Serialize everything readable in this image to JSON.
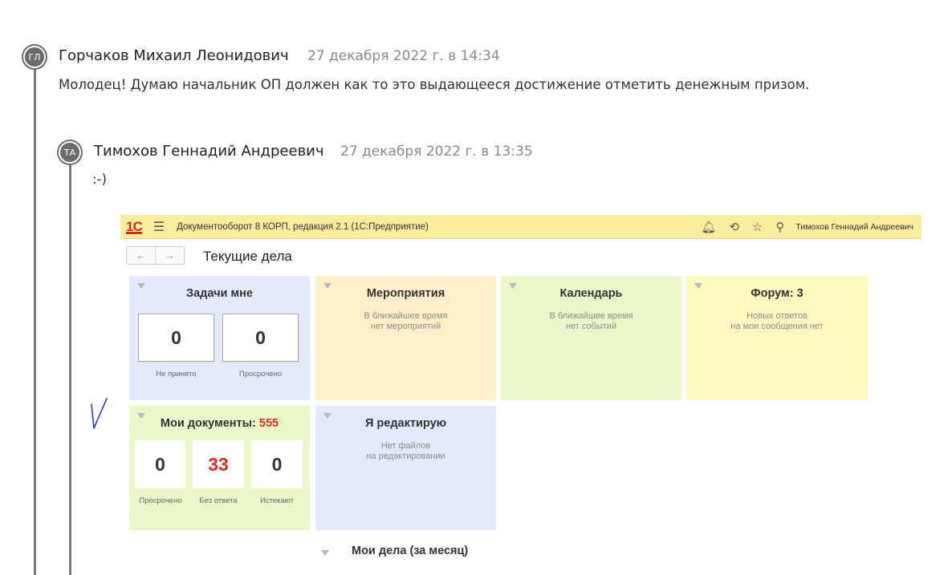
{
  "comments": [
    {
      "avatar_initials": "ГЛ",
      "author": "Горчаков Михаил Леонидович",
      "date": "27 декабря 2022 г. в 14:34",
      "text": "Молодец! Думаю начальник ОП должен как то это выдающееся достижение отметить денежным призом."
    },
    {
      "avatar_initials": "ТА",
      "author": "Тимохов Геннадий Андреевич",
      "date": "27 декабря 2022 г. в 13:35",
      "text": ":-)"
    }
  ],
  "screenshot": {
    "logo": "1С",
    "app_title": "Документооборот 8 КОРП, редакция 2.1  (1С:Предприятие)",
    "user": "Тимохов Геннадий Андреевич",
    "nav_back": "←",
    "nav_forward": "→",
    "page_title": "Текущие дела",
    "tiles": {
      "tasks": {
        "title": "Задачи мне",
        "counters": [
          {
            "value": "0",
            "label": "Не принято"
          },
          {
            "value": "0",
            "label": "Просрочено"
          }
        ]
      },
      "events": {
        "title": "Мероприятия",
        "sub1": "В ближайшее время",
        "sub2": "нет мероприятий"
      },
      "calendar": {
        "title": "Календарь",
        "sub1": "В ближайшее время",
        "sub2": "нет событий"
      },
      "forum": {
        "title": "Форум: 3",
        "sub1": "Новых ответов",
        "sub2": "на мои сообщения нет"
      },
      "documents": {
        "title": "Мои документы:",
        "count": "555",
        "counters": [
          {
            "value": "0",
            "label": "Просрочено"
          },
          {
            "value": "33",
            "label": "Без ответа"
          },
          {
            "value": "0",
            "label": "Истекают"
          }
        ]
      },
      "editing": {
        "title": "Я редактирую",
        "sub1": "Нет файлов",
        "sub2": "на редактировании"
      }
    },
    "bottom_title": "Мои дела (за месяц)"
  },
  "colors": {
    "topbar": "#fbed9e",
    "tile_blue": "#e3eafa",
    "tile_orange": "#fdefc8",
    "tile_green": "#eaf7c8",
    "tile_yellow": "#fbf8c0",
    "accent_red": "#d8311f"
  }
}
